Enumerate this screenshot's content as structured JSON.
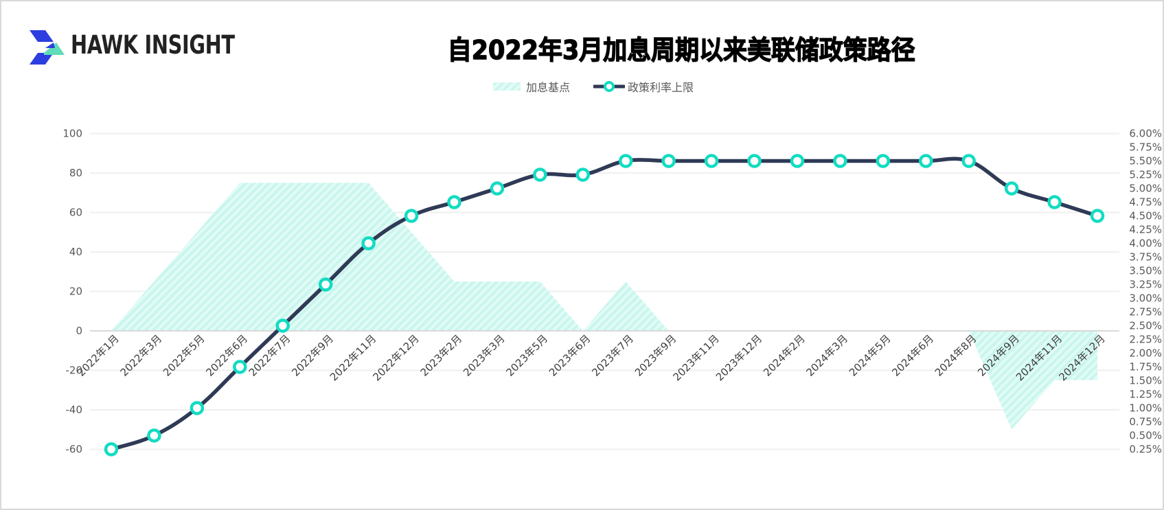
{
  "brand": {
    "name": "HAWK INSIGHT",
    "colors": {
      "blue": "#2d3ee0",
      "green": "#5fdcb8",
      "text": "#222222"
    }
  },
  "chart_data": {
    "type": "line",
    "title": "自2022年3月加息周期以来美联储政策路径",
    "legend": {
      "placement": "top-center",
      "items": [
        {
          "name": "加息基点",
          "kind": "area"
        },
        {
          "name": "政策利率上限",
          "kind": "line-marker"
        }
      ]
    },
    "categories": [
      "2022年1月",
      "2022年3月",
      "2022年5月",
      "2022年6月",
      "2022年7月",
      "2022年9月",
      "2022年11月",
      "2022年12月",
      "2023年2月",
      "2023年3月",
      "2023年5月",
      "2023年6月",
      "2023年7月",
      "2023年9月",
      "2023年11月",
      "2023年12月",
      "2024年2月",
      "2024年3月",
      "2024年5月",
      "2024年6月",
      "2024年8月",
      "2024年9月",
      "2024年11月",
      "2024年12月"
    ],
    "series": [
      {
        "name": "加息基点",
        "type": "area",
        "axis": "left",
        "color": "#c9f6ee",
        "values": [
          0,
          25,
          50,
          75,
          75,
          75,
          75,
          50,
          25,
          25,
          25,
          0,
          25,
          0,
          0,
          0,
          0,
          0,
          0,
          0,
          0,
          -50,
          -25,
          -25
        ]
      },
      {
        "name": "政策利率上限",
        "type": "line",
        "axis": "right",
        "color": "#2f3a56",
        "marker_color": "#12dcc2",
        "unit": "%",
        "values": [
          0.25,
          0.5,
          1.0,
          1.75,
          2.5,
          3.25,
          4.0,
          4.5,
          4.75,
          5.0,
          5.25,
          5.25,
          5.5,
          5.5,
          5.5,
          5.5,
          5.5,
          5.5,
          5.5,
          5.5,
          5.5,
          5.0,
          4.75,
          4.5
        ]
      }
    ],
    "y_left": {
      "ylim": [
        -60,
        100
      ],
      "ticks": [
        "100",
        "80",
        "60",
        "40",
        "20",
        "0",
        "-20",
        "-40",
        "-60"
      ],
      "tick_values": [
        100,
        80,
        60,
        40,
        20,
        0,
        -20,
        -40,
        -60
      ]
    },
    "y_right": {
      "ylim": [
        0.25,
        6.0
      ],
      "ticks": [
        "6.00%",
        "5.75%",
        "5.50%",
        "5.25%",
        "5.00%",
        "4.75%",
        "4.50%",
        "4.25%",
        "4.00%",
        "3.75%",
        "3.50%",
        "3.25%",
        "3.00%",
        "2.75%",
        "2.50%",
        "2.25%",
        "2.00%",
        "1.75%",
        "1.50%",
        "1.25%",
        "1.00%",
        "0.75%",
        "0.50%",
        "0.25%"
      ]
    },
    "grid": true,
    "xlabel": "",
    "ylabel": ""
  }
}
